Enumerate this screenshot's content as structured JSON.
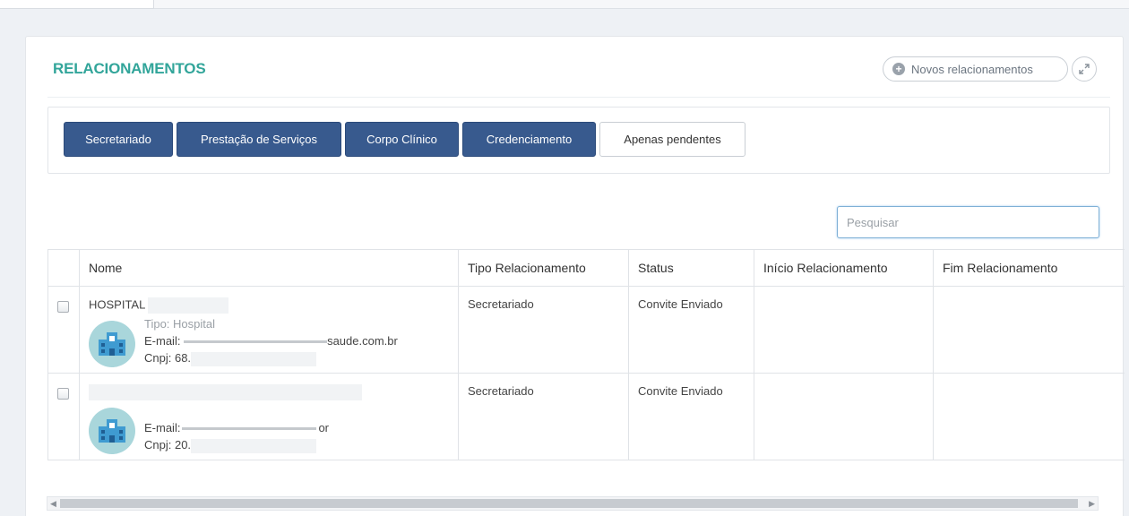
{
  "panel": {
    "title": "RELACIONAMENTOS",
    "new_button_label": "Novos relacionamentos",
    "new_button_icon": "plus-icon",
    "expand_icon": "expand-icon"
  },
  "filters": [
    {
      "label": "Secretariado",
      "style": "dark"
    },
    {
      "label": "Prestação de Serviços",
      "style": "dark"
    },
    {
      "label": "Corpo Clínico",
      "style": "dark"
    },
    {
      "label": "Credenciamento",
      "style": "dark"
    },
    {
      "label": "Apenas pendentes",
      "style": "light"
    }
  ],
  "search": {
    "placeholder": "Pesquisar",
    "value": ""
  },
  "table": {
    "columns": [
      "Nome",
      "Tipo Relacionamento",
      "Status",
      "Início Relacionamento",
      "Fim Relacionamento"
    ],
    "rows": [
      {
        "name": "HOSPITAL",
        "tipo_line": "Tipo: Hospital",
        "email": "E-mail: ",
        "email_visible": "saude.com.br",
        "cnpj": "Cnpj: 68.",
        "tipo_relacionamento": "Secretariado",
        "status": "Convite Enviado",
        "inicio": "",
        "fim": "",
        "avatar_icon": "hospital-icon"
      },
      {
        "name": "",
        "tipo_line": "",
        "email": "E-mail:",
        "email_visible": "or",
        "cnpj": "Cnpj: 20.",
        "tipo_relacionamento": "Secretariado",
        "status": "Convite Enviado",
        "inicio": "",
        "fim": "",
        "avatar_icon": "hospital-icon"
      }
    ]
  },
  "colors": {
    "title": "#32a59a",
    "primary_button": "#385a8e",
    "avatar_bg": "#a9d6db"
  }
}
